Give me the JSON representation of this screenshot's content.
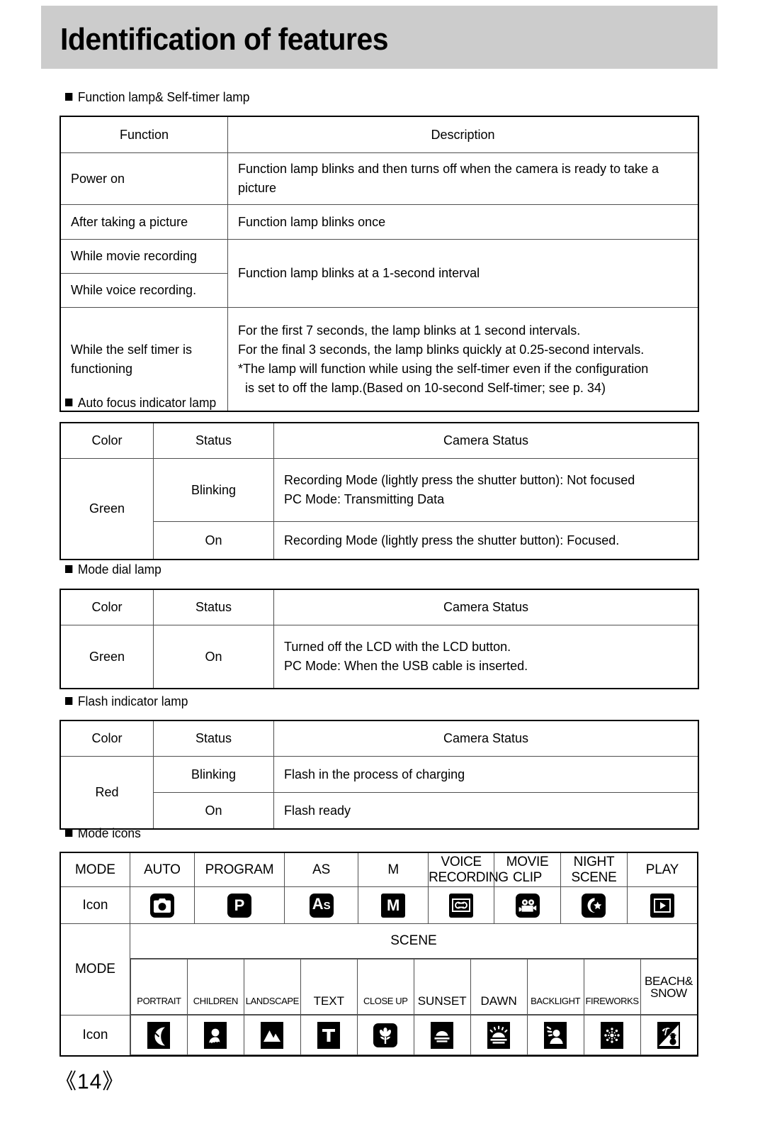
{
  "header": {
    "title": "Identification of features",
    "banner_color": "#cccccc"
  },
  "sections": [
    {
      "caption": "Function lamp& Self-timer lamp"
    },
    {
      "caption": "Auto focus indicator lamp"
    },
    {
      "caption": "Mode dial lamp"
    },
    {
      "caption": "Flash indicator lamp"
    },
    {
      "caption": "Mode icons"
    }
  ],
  "function_lamp_table": {
    "headers": [
      "Function",
      "Description"
    ],
    "rows": [
      {
        "function": "Power on",
        "description": "Function lamp blinks and then turns off when the camera is ready to take a picture"
      },
      {
        "function": "After taking a picture",
        "description": "Function lamp blinks once"
      },
      {
        "function": "While movie recording",
        "description": "Function lamp blinks at a 1-second interval"
      },
      {
        "function": "While voice recording.",
        "description": ""
      },
      {
        "function": "While the self timer is functioning",
        "description_lines": [
          "For the first 7 seconds, the lamp blinks at 1 second intervals.",
          "For the final 3 seconds, the lamp blinks quickly at 0.25-second intervals.",
          "*The lamp will function while using the self-timer even if the configuration",
          "  is set to off the lamp.(Based on 10-second Self-timer; see p. 34)"
        ]
      }
    ]
  },
  "autofocus_table": {
    "headers": [
      "Color",
      "Status",
      "Camera Status"
    ],
    "color": "Green",
    "rows": [
      {
        "status": "Blinking",
        "camera_status_lines": [
          "Recording Mode (lightly press the shutter button): Not focused",
          "PC Mode: Transmitting Data"
        ]
      },
      {
        "status": "On",
        "camera_status_lines": [
          "Recording Mode (lightly press the shutter button): Focused."
        ]
      }
    ]
  },
  "modedial_table": {
    "headers": [
      "Color",
      "Status",
      "Camera Status"
    ],
    "color": "Green",
    "rows": [
      {
        "status": "On",
        "camera_status_lines": [
          "Turned off the LCD with the LCD button.",
          "PC Mode: When the USB cable is inserted."
        ]
      }
    ]
  },
  "flash_table": {
    "headers": [
      "Color",
      "Status",
      "Camera Status"
    ],
    "color": "Red",
    "rows": [
      {
        "status": "Blinking",
        "camera_status": "Flash in the process of charging"
      },
      {
        "status": "On",
        "camera_status": "Flash ready"
      }
    ]
  },
  "mode_icons_table": {
    "row_labels": {
      "mode": "MODE",
      "icon": "Icon",
      "scene": "SCENE"
    },
    "main_modes": [
      {
        "label": "AUTO",
        "icon": "camera-icon"
      },
      {
        "label": "PROGRAM",
        "icon": "letter-p-icon"
      },
      {
        "label": "AS",
        "icon": "letter-as-icon"
      },
      {
        "label": "M",
        "icon": "letter-m-icon"
      },
      {
        "label": "VOICE RECORDING",
        "icon": "cassette-tape-icon"
      },
      {
        "label": "MOVIE CLIP",
        "icon": "movie-camera-icon"
      },
      {
        "label": "NIGHT SCENE",
        "icon": "moon-star-icon"
      },
      {
        "label": "PLAY",
        "icon": "play-triangle-icon"
      }
    ],
    "scene_modes": [
      {
        "label": "PORTRAIT",
        "icon": "face-profile-icon"
      },
      {
        "label": "CHILDREN",
        "icon": "person-bust-icon"
      },
      {
        "label": "LANDSCAPE",
        "icon": "mountains-icon"
      },
      {
        "label": "TEXT",
        "icon": "letter-t-icon"
      },
      {
        "label": "CLOSE UP",
        "icon": "tulip-flower-icon"
      },
      {
        "label": "SUNSET",
        "icon": "sunset-icon"
      },
      {
        "label": "DAWN",
        "icon": "dawn-sunrise-icon"
      },
      {
        "label": "BACKLIGHT",
        "icon": "backlight-person-icon"
      },
      {
        "label": "FIREWORKS",
        "icon": "fireworks-burst-icon"
      },
      {
        "label_line1": "BEACH&",
        "label_line2": "SNOW",
        "icon": "beach-snow-icon"
      }
    ]
  },
  "footer": {
    "page_number": "《14》"
  }
}
